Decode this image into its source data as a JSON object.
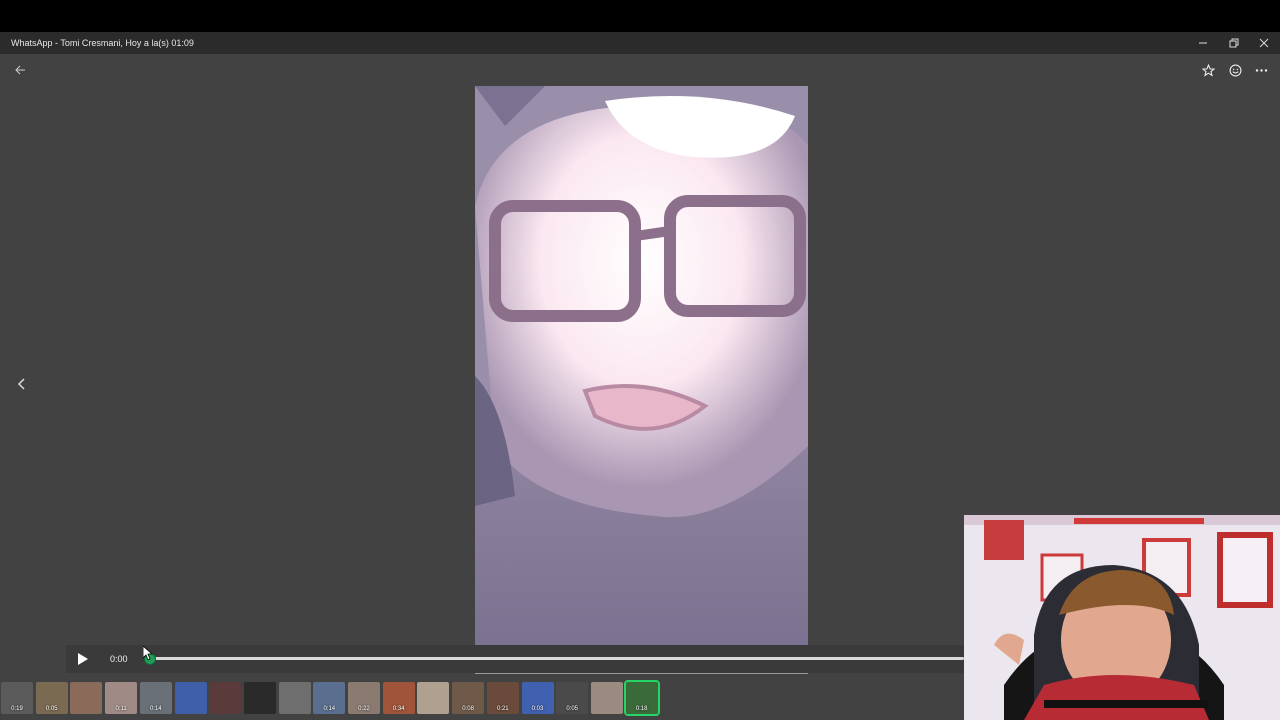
{
  "window": {
    "title": "WhatsApp - Tomi Cresmani, Hoy a la(s) 01:09",
    "controls": {
      "minimize": "minimize-icon",
      "restore": "restore-icon",
      "close": "close-icon"
    }
  },
  "toolbar": {
    "back": "back-arrow-icon",
    "star": "star-icon",
    "react": "emoji-icon",
    "more": "more-icon"
  },
  "player": {
    "current_time": "0:00",
    "progress": 0
  },
  "thumbnails": [
    {
      "duration": "0:19"
    },
    {
      "duration": "0:05"
    },
    {
      "duration": ""
    },
    {
      "duration": "0:11"
    },
    {
      "duration": "0:14"
    },
    {
      "duration": ""
    },
    {
      "duration": ""
    },
    {
      "duration": ""
    },
    {
      "duration": ""
    },
    {
      "duration": "0:14"
    },
    {
      "duration": "0:22"
    },
    {
      "duration": "0:34"
    },
    {
      "duration": ""
    },
    {
      "duration": "0:08"
    },
    {
      "duration": "0:21"
    },
    {
      "duration": "0:03"
    },
    {
      "duration": "0:05"
    },
    {
      "duration": ""
    },
    {
      "duration": "0:18"
    }
  ],
  "colors": {
    "accent": "#25d366",
    "viewer_bg": "#424242",
    "titlebar_bg": "#2b2b2b"
  }
}
